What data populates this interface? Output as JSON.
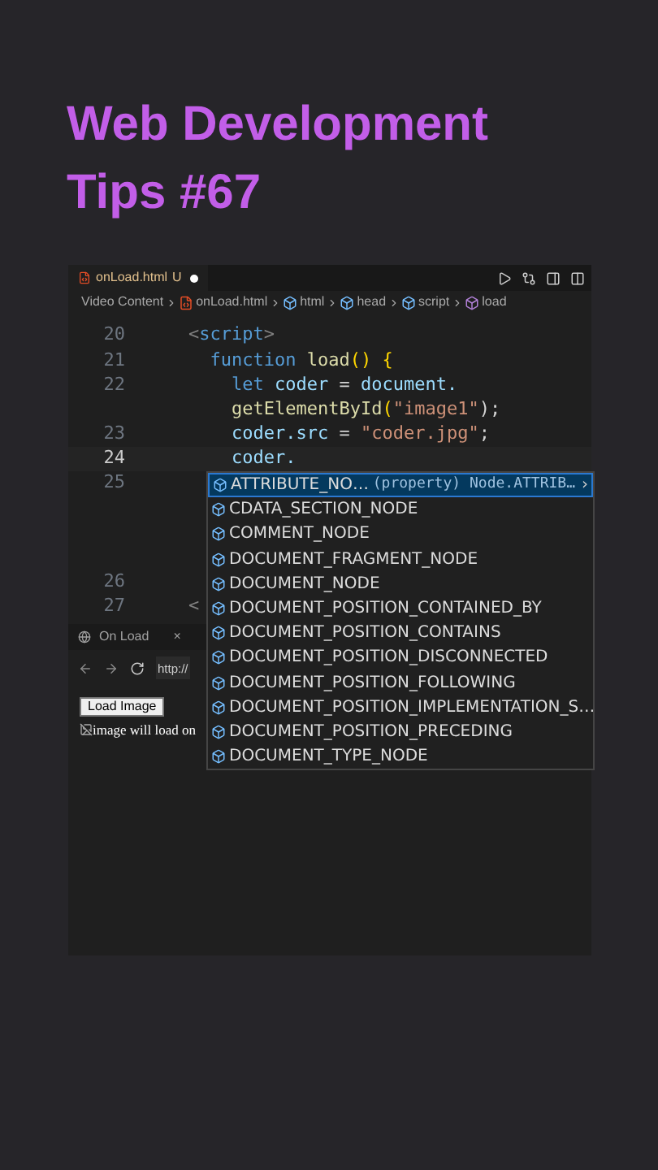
{
  "title": "Web Development Tips #67",
  "editor": {
    "tab": {
      "name": "onLoad.html",
      "status": "U",
      "modified": true
    },
    "breadcrumbs": [
      {
        "label": "Video Content",
        "kind": "folder"
      },
      {
        "label": "onLoad.html",
        "kind": "file"
      },
      {
        "label": "html",
        "kind": "element"
      },
      {
        "label": "head",
        "kind": "element"
      },
      {
        "label": "script",
        "kind": "element"
      },
      {
        "label": "load",
        "kind": "function"
      }
    ],
    "lines": [
      {
        "number": "20",
        "current": false,
        "tokens": [
          {
            "text": "<",
            "kind": "punct"
          },
          {
            "text": "script",
            "kind": "tag"
          },
          {
            "text": ">",
            "kind": "punct"
          }
        ]
      },
      {
        "number": "21",
        "current": false,
        "tokens": [
          {
            "text": "  function",
            "kind": "keyword"
          },
          {
            "text": " load",
            "kind": "func"
          },
          {
            "text": "()",
            "kind": "bracket"
          },
          {
            "text": " {",
            "kind": "bracket"
          }
        ]
      },
      {
        "number": "22",
        "current": false,
        "tokens": [
          {
            "text": "    let",
            "kind": "keyword"
          },
          {
            "text": " coder",
            "kind": "var"
          },
          {
            "text": " = ",
            "kind": "plain"
          },
          {
            "text": "document.",
            "kind": "var"
          }
        ]
      },
      {
        "tokens": [
          {
            "text": "    getElementById",
            "kind": "func"
          },
          {
            "text": "(",
            "kind": "bracket"
          },
          {
            "text": "\"image1\"",
            "kind": "string"
          },
          {
            "text": ");",
            "kind": "plain"
          }
        ]
      },
      {
        "number": "23",
        "current": false,
        "tokens": [
          {
            "text": "    coder.src",
            "kind": "var"
          },
          {
            "text": " = ",
            "kind": "plain"
          },
          {
            "text": "\"coder.jpg\"",
            "kind": "string"
          },
          {
            "text": ";",
            "kind": "plain"
          }
        ]
      },
      {
        "number": "24",
        "current": true,
        "tokens": [
          {
            "text": "    coder.",
            "kind": "var"
          }
        ]
      },
      {
        "number": "25",
        "current": false,
        "wrapped": true
      },
      {
        "number": "26",
        "current": false
      },
      {
        "number": "27",
        "current": false,
        "tokens": [
          {
            "text": "<",
            "kind": "punct"
          }
        ]
      }
    ],
    "suggestions": [
      {
        "label": "ATTRIBUTE_NO…",
        "detail": "(property) Node.ATTRIB…",
        "more": "›",
        "selected": true
      },
      {
        "label": "CDATA_SECTION_NODE",
        "selected": false
      },
      {
        "label": "COMMENT_NODE",
        "selected": false
      },
      {
        "label": "DOCUMENT_FRAGMENT_NODE",
        "selected": false
      },
      {
        "label": "DOCUMENT_NODE",
        "selected": false
      },
      {
        "label": "DOCUMENT_POSITION_CONTAINED_BY",
        "selected": false
      },
      {
        "label": "DOCUMENT_POSITION_CONTAINS",
        "selected": false
      },
      {
        "label": "DOCUMENT_POSITION_DISCONNECTED",
        "selected": false
      },
      {
        "label": "DOCUMENT_POSITION_FOLLOWING",
        "selected": false
      },
      {
        "label": "DOCUMENT_POSITION_IMPLEMENTATION_S…",
        "selected": false
      },
      {
        "label": "DOCUMENT_POSITION_PRECEDING",
        "selected": false
      },
      {
        "label": "DOCUMENT_TYPE_NODE",
        "selected": false
      }
    ],
    "browser": {
      "tab": "On Load",
      "close": "×",
      "url": "http://",
      "button": "Load Image",
      "image_alt": "image will load on"
    }
  }
}
